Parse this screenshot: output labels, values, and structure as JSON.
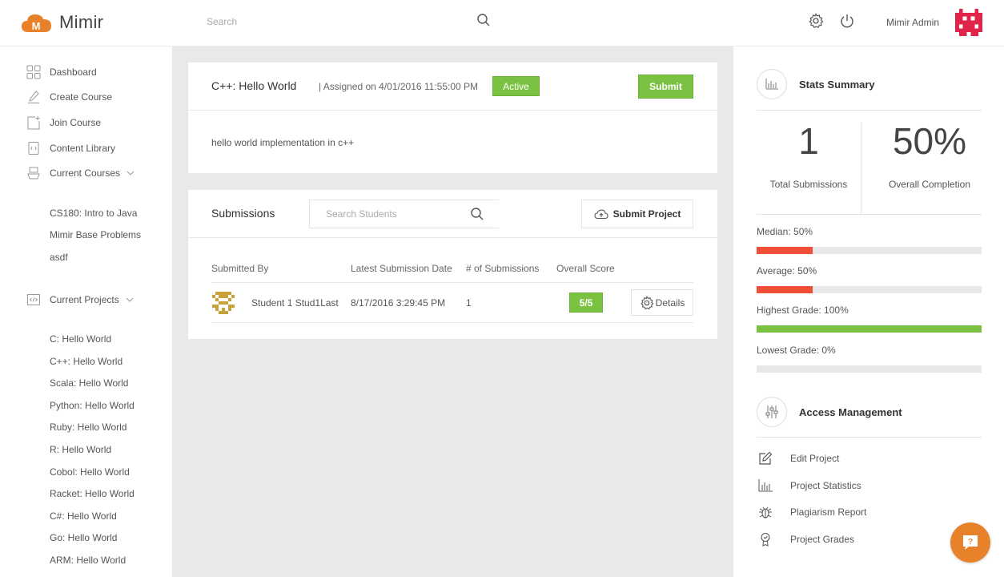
{
  "app": {
    "name": "Mimir"
  },
  "header": {
    "search_placeholder": "Search",
    "user_name": "Mimir Admin"
  },
  "sidebar": {
    "items": [
      {
        "label": "Dashboard",
        "icon": "dashboard-icon"
      },
      {
        "label": "Create Course",
        "icon": "pencil-icon"
      },
      {
        "label": "Join Course",
        "icon": "add-page-icon"
      },
      {
        "label": "Content Library",
        "icon": "library-icon"
      },
      {
        "label": "Current Courses",
        "icon": "course-icon"
      }
    ],
    "courses": [
      "CS180: Intro to Java",
      "Mimir Base Problems",
      "asdf"
    ],
    "projects_label": "Current Projects",
    "projects": [
      "C: Hello World",
      "C++: Hello World",
      "Scala: Hello World",
      "Python: Hello World",
      "Ruby: Hello World",
      "R: Hello World",
      "Cobol: Hello World",
      "Racket: Hello World",
      "C#: Hello World",
      "Go: Hello World",
      "ARM: Hello World"
    ]
  },
  "project": {
    "title": "C++: Hello World",
    "assigned": "| Assigned on 4/01/2016 11:55:00 PM",
    "status": "Active",
    "submit_label": "Submit",
    "description": "hello world implementation in c++"
  },
  "submissions": {
    "title": "Submissions",
    "search_placeholder": "Search Students",
    "submit_project_label": "Submit Project",
    "columns": [
      "Submitted By",
      "Latest Submission Date",
      "# of Submissions",
      "Overall Score"
    ],
    "rows": [
      {
        "student": "Student 1 Stud1Last",
        "date": "8/17/2016 3:29:45 PM",
        "count": "1",
        "score": "5/5",
        "details_label": "Details"
      }
    ]
  },
  "stats": {
    "title": "Stats Summary",
    "total_submissions": "1",
    "total_submissions_label": "Total Submissions",
    "overall_completion": "50%",
    "overall_completion_label": "Overall Completion",
    "bars": [
      {
        "label": "Median: 50%",
        "value": 0.5,
        "color": "#f04e37"
      },
      {
        "label": "Average: 50%",
        "value": 0.5,
        "color": "#f04e37"
      },
      {
        "label": "Highest Grade: 100%",
        "value": 1.0,
        "color": "#7cc242"
      },
      {
        "label": "Lowest Grade: 0%",
        "value": 0.0,
        "color": "#f04e37"
      }
    ]
  },
  "access": {
    "title": "Access Management",
    "items": [
      {
        "label": "Edit Project",
        "icon": "edit-icon"
      },
      {
        "label": "Project Statistics",
        "icon": "bar-chart-icon"
      },
      {
        "label": "Plagiarism Report",
        "icon": "bug-icon"
      },
      {
        "label": "Project Grades",
        "icon": "award-icon"
      }
    ]
  },
  "help": {
    "label": "?"
  },
  "colors": {
    "accent_green": "#7cc242",
    "accent_red": "#f04e37",
    "brand_orange": "#e8822a"
  }
}
